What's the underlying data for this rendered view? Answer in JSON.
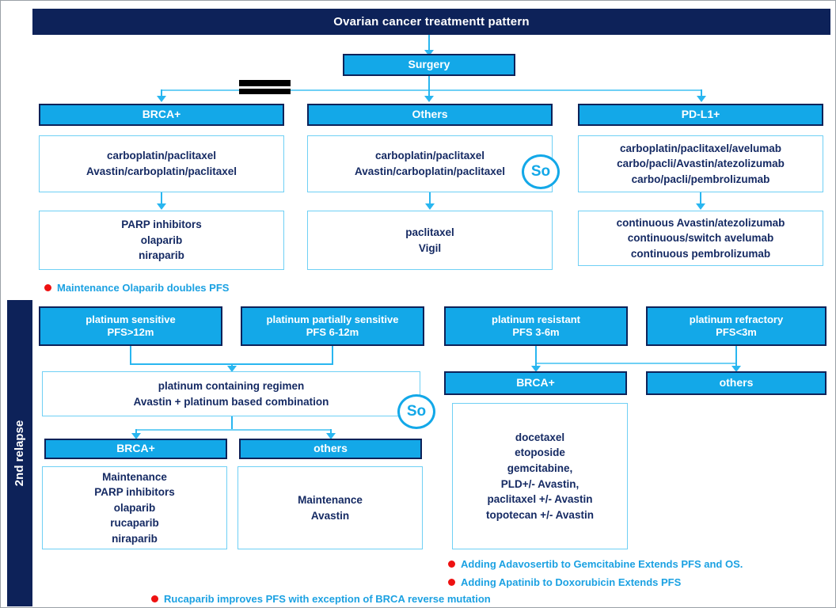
{
  "header": {
    "title": "Ovarian cancer treatmentt pattern"
  },
  "first_line": {
    "root": {
      "label": "Surgery"
    },
    "branches": [
      {
        "header": "BRCA+",
        "treatment": "carboplatin/paclitaxel\nAvastin/carboplatin/paclitaxel",
        "maintenance": "PARP inhibitors\nolaparib\nniraparib"
      },
      {
        "header": "Others",
        "treatment": "carboplatin/paclitaxel\nAvastin/carboplatin/paclitaxel",
        "maintenance": "paclitaxel\nVigil"
      },
      {
        "header": "PD-L1+",
        "treatment": "carboplatin/paclitaxel/avelumab\ncarbo/pacli/Avastin/atezolizumab\ncarbo/pacli/pembrolizumab",
        "maintenance": "continuous Avastin/atezolizumab\ncontinuous/switch avelumab\ncontinuous pembrolizumab"
      }
    ],
    "note": "Maintenance Olaparib doubles PFS"
  },
  "relapse": {
    "band_label": "2nd relapse",
    "categories": [
      {
        "name": "platinum sensitive",
        "pfs": "PFS>12m"
      },
      {
        "name": "platinum partially sensitive",
        "pfs": "PFS 6-12m"
      },
      {
        "name": "platinum resistant",
        "pfs": "PFS 3-6m"
      },
      {
        "name": "platinum refractory",
        "pfs": "PFS<3m"
      }
    ],
    "sensitive_regimen": "platinum containing regimen\nAvastin + platinum based combination",
    "sensitive_subgroups": [
      {
        "header": "BRCA+",
        "maintenance": "Maintenance\nPARP inhibitors\nolaparib\nrucaparib\nniraparib"
      },
      {
        "header": "others",
        "maintenance": "Maintenance\nAvastin"
      }
    ],
    "resistant_subgroups": [
      {
        "header": "BRCA+",
        "treatment": "docetaxel\netoposide\ngemcitabine,\nPLD+/- Avastin,\npaclitaxel +/- Avastin\ntopotecan +/- Avastin"
      },
      {
        "header": "others",
        "treatment": ""
      }
    ],
    "notes": [
      "Adding Adavosertib to Gemcitabine Extends PFS and OS.",
      "Adding Apatinib  to Doxorubicin Extends PFS",
      "Rucaparib improves PFS with exception of BRCA reverse mutation"
    ]
  },
  "badges": {
    "so_label_1": "So",
    "so_label_2": "So"
  },
  "colors": {
    "navy": "#0d2259",
    "cyan": "#13a8e8",
    "light_cyan": "#6fd0f5",
    "text_navy": "#152a63",
    "note_blue": "#1ba1e2",
    "bullet_red": "#ee1111"
  }
}
